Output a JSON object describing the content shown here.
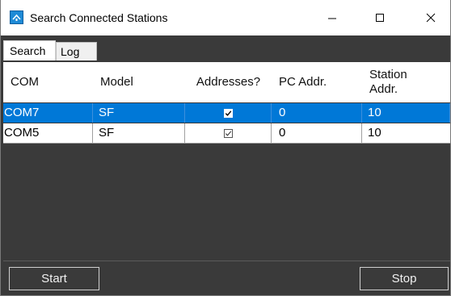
{
  "window": {
    "title": "Search Connected Stations"
  },
  "tabs": [
    {
      "label": "Search"
    },
    {
      "label": "Log"
    }
  ],
  "table": {
    "columns": [
      "COM",
      "Model",
      "Addresses?",
      "PC Addr.",
      "Station\nAddr."
    ],
    "rows": [
      {
        "com": "COM7",
        "model": "SF",
        "addresses": true,
        "pc_addr": "0",
        "station_addr": "10",
        "selected": true
      },
      {
        "com": "COM5",
        "model": "SF",
        "addresses": true,
        "pc_addr": "0",
        "station_addr": "10",
        "selected": false
      }
    ]
  },
  "buttons": {
    "start": "Start",
    "stop": "Stop"
  },
  "colors": {
    "selection": "#0078d7",
    "panel": "#3a3a3a"
  }
}
